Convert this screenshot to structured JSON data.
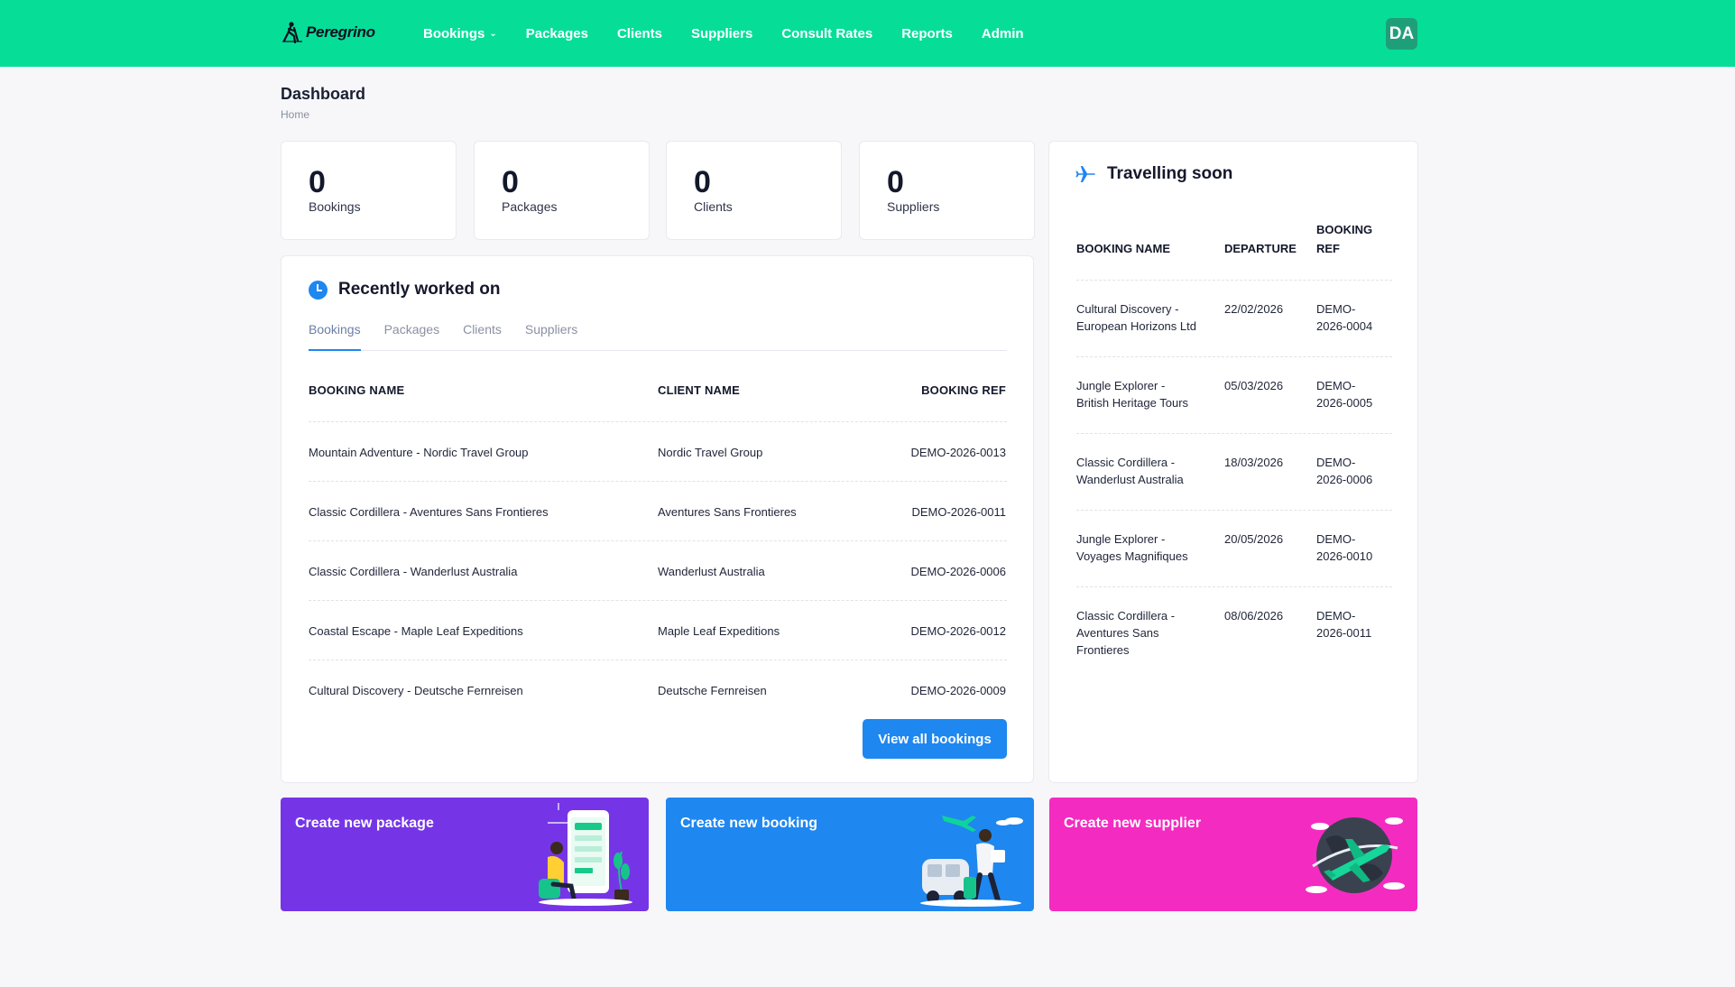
{
  "app": {
    "logo_text": "Peregrino",
    "avatar_initials": "DA"
  },
  "nav": {
    "items": [
      {
        "label": "Bookings",
        "has_dropdown": true
      },
      {
        "label": "Packages"
      },
      {
        "label": "Clients"
      },
      {
        "label": "Suppliers"
      },
      {
        "label": "Consult Rates"
      },
      {
        "label": "Reports"
      },
      {
        "label": "Admin"
      }
    ]
  },
  "page": {
    "title": "Dashboard",
    "breadcrumb": "Home"
  },
  "stats": [
    {
      "value": "0",
      "label": "Bookings"
    },
    {
      "value": "0",
      "label": "Packages"
    },
    {
      "value": "0",
      "label": "Clients"
    },
    {
      "value": "0",
      "label": "Suppliers"
    }
  ],
  "recent": {
    "title": "Recently worked on",
    "tabs": [
      "Bookings",
      "Packages",
      "Clients",
      "Suppliers"
    ],
    "active_tab": "Bookings",
    "columns": [
      "BOOKING NAME",
      "CLIENT NAME",
      "BOOKING REF"
    ],
    "rows": [
      {
        "booking_name": "Mountain Adventure - Nordic Travel Group",
        "client_name": "Nordic Travel Group",
        "booking_ref": "DEMO-2026-0013"
      },
      {
        "booking_name": "Classic Cordillera - Aventures Sans Frontieres",
        "client_name": "Aventures Sans Frontieres",
        "booking_ref": "DEMO-2026-0011"
      },
      {
        "booking_name": "Classic Cordillera - Wanderlust Australia",
        "client_name": "Wanderlust Australia",
        "booking_ref": "DEMO-2026-0006"
      },
      {
        "booking_name": "Coastal Escape - Maple Leaf Expeditions",
        "client_name": "Maple Leaf Expeditions",
        "booking_ref": "DEMO-2026-0012"
      },
      {
        "booking_name": "Cultural Discovery - Deutsche Fernreisen",
        "client_name": "Deutsche Fernreisen",
        "booking_ref": "DEMO-2026-0009"
      }
    ],
    "view_all_label": "View all bookings"
  },
  "travelling": {
    "title": "Travelling soon",
    "columns": {
      "name": "BOOKING NAME",
      "departure": "DEPARTURE",
      "ref_line1": "BOOKING",
      "ref_line2": "REF"
    },
    "rows": [
      {
        "name_lines": [
          "Cultural Discovery -",
          "European Horizons Ltd"
        ],
        "departure": "22/02/2026",
        "ref_lines": [
          "DEMO-",
          "2026-0004"
        ]
      },
      {
        "name_lines": [
          "Jungle Explorer -",
          "British Heritage Tours"
        ],
        "departure": "05/03/2026",
        "ref_lines": [
          "DEMO-",
          "2026-0005"
        ]
      },
      {
        "name_lines": [
          "Classic Cordillera -",
          "Wanderlust Australia"
        ],
        "departure": "18/03/2026",
        "ref_lines": [
          "DEMO-",
          "2026-0006"
        ]
      },
      {
        "name_lines": [
          "Jungle Explorer -",
          "Voyages Magnifiques"
        ],
        "departure": "20/05/2026",
        "ref_lines": [
          "DEMO-",
          "2026-0010"
        ]
      },
      {
        "name_lines": [
          "Classic Cordillera -",
          "Aventures Sans",
          "Frontieres"
        ],
        "departure": "08/06/2026",
        "ref_lines": [
          "DEMO-",
          "2026-0011"
        ]
      }
    ]
  },
  "tiles": [
    {
      "label": "Create new package",
      "color": "#7535e6",
      "icon": "phone-shopping-illustration"
    },
    {
      "label": "Create new booking",
      "color": "#1e87f0",
      "icon": "traveller-van-illustration"
    },
    {
      "label": "Create new supplier",
      "color": "#f42bc1",
      "icon": "globe-plane-illustration"
    }
  ],
  "colors": {
    "brand": "#06de98",
    "accent": "#1e87f0",
    "background": "#f7f7f9"
  }
}
